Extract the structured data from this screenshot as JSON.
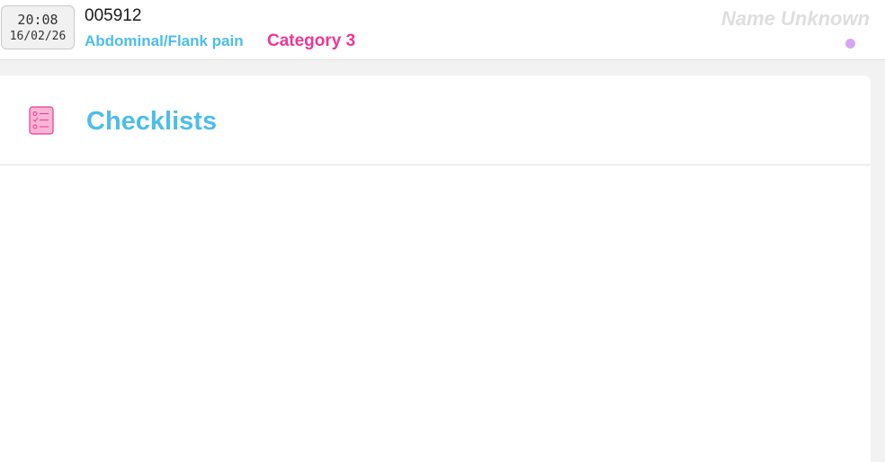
{
  "header": {
    "time": "20:08",
    "date": "16/02/26",
    "incident_id": "005912",
    "chief_complaint": "Abdominal/Flank pain",
    "category": "Category 3",
    "patient_name": "Name Unknown",
    "status_dot_color": "#d6a6f4"
  },
  "panel": {
    "title": "Checklists",
    "icon": "checklist-icon"
  },
  "colors": {
    "accent_blue": "#4dbde9",
    "accent_pink": "#ec3796",
    "background": "#f2f2f2"
  }
}
